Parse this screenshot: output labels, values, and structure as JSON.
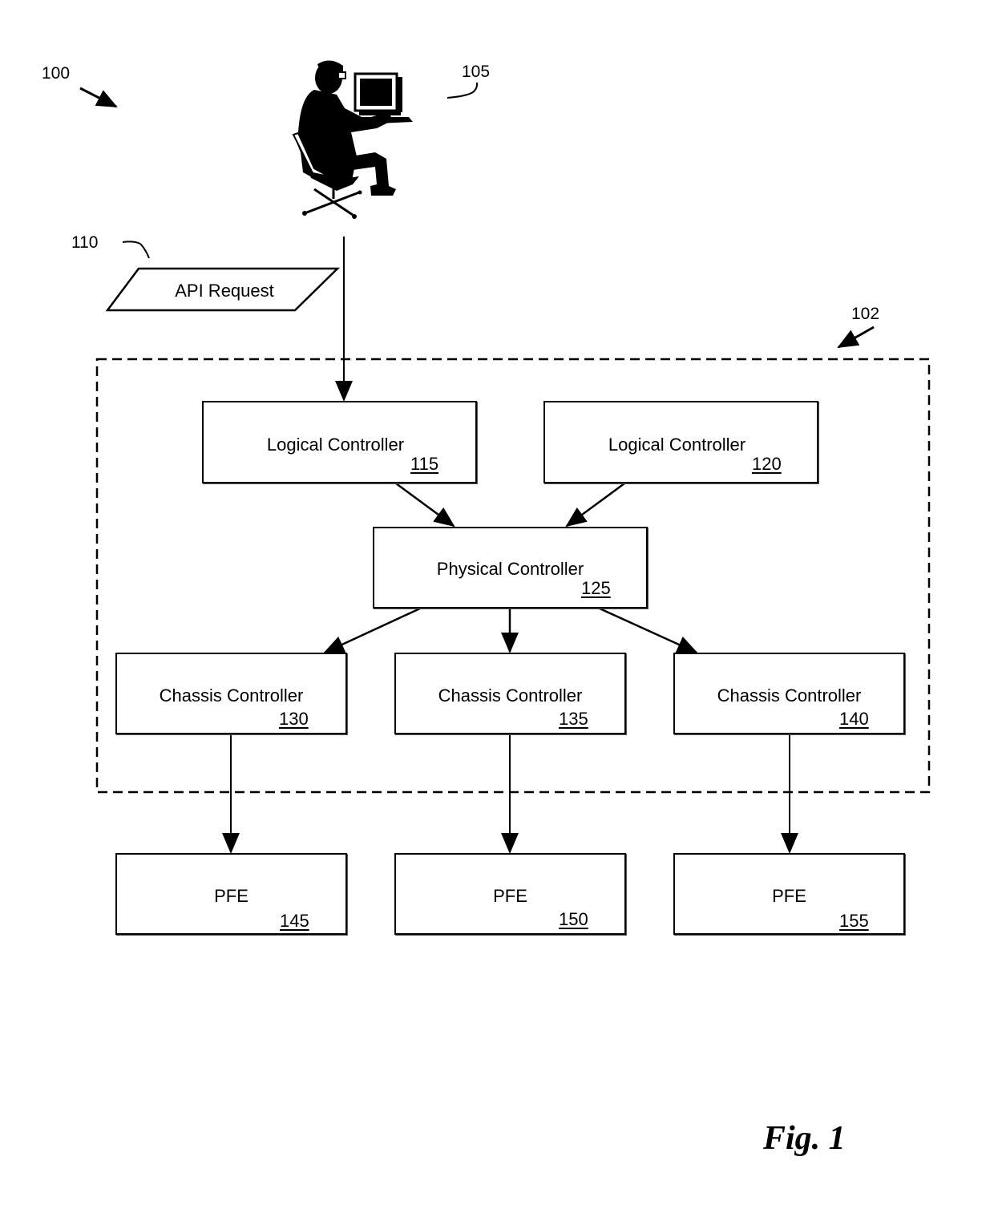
{
  "figure": {
    "label": "Fig. 1",
    "system_ref": "100",
    "controller_cluster_ref": "102"
  },
  "user": {
    "ref": "105",
    "icon": "person-at-computer-icon"
  },
  "api_request": {
    "label": "API Request",
    "ref": "110"
  },
  "logical_controllers": [
    {
      "label": "Logical Controller",
      "ref": "115"
    },
    {
      "label": "Logical Controller",
      "ref": "120"
    }
  ],
  "physical_controller": {
    "label": "Physical Controller",
    "ref": "125"
  },
  "chassis_controllers": [
    {
      "label": "Chassis Controller",
      "ref": "130"
    },
    {
      "label": "Chassis Controller",
      "ref": "135"
    },
    {
      "label": "Chassis Controller",
      "ref": "140"
    }
  ],
  "pfes": [
    {
      "label": "PFE",
      "ref": "145"
    },
    {
      "label": "PFE",
      "ref": "150"
    },
    {
      "label": "PFE",
      "ref": "155"
    }
  ]
}
